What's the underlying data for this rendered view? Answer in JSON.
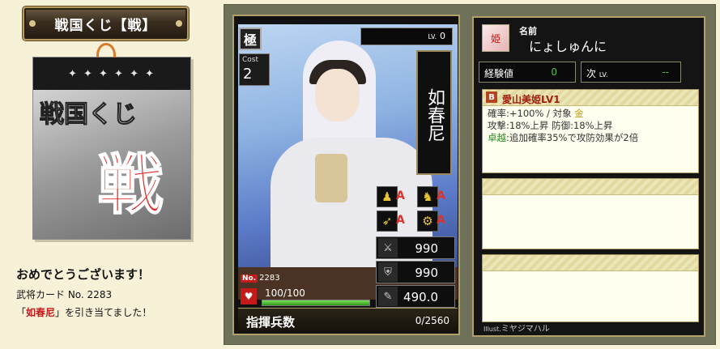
{
  "left": {
    "title": "戦国くじ【戦】",
    "art": {
      "strip_text": "✦ ✦ ✦ ✦ ✦ ✦",
      "big_text": "戦国くじ",
      "big_red": "戦"
    },
    "messages": {
      "congrats": "おめでとうございます！",
      "card_line": "武将カード No. 2283",
      "result_prefix": "「",
      "result_name": "如春尼",
      "result_suffix": "」を引き当てました！"
    }
  },
  "card": {
    "rarity": "極",
    "cost_label": "Cost",
    "cost_value": "2",
    "level_label": "LV.",
    "level_value": "0",
    "name": "如春尼",
    "skill_icons": [
      "spear-icon",
      "horse-icon",
      "bow-icon",
      "cannon-icon"
    ],
    "skill_grades": [
      "A",
      "A",
      "A",
      "A"
    ],
    "stats": {
      "attack": "990",
      "defense": "990",
      "speed": "490.0"
    },
    "number_label": "No.",
    "number": "2283",
    "hp_text": "100/100",
    "hp_fraction": 1.0,
    "troop_label": "指揮兵数",
    "troop_value": "0/2560"
  },
  "info": {
    "avatar_text": "姫",
    "name_label": "名前",
    "name_value": "にょしゅんに",
    "exp_label": "経験値",
    "exp_value": "0",
    "next_label": "次",
    "next_label_small": "LV.",
    "next_value": "--",
    "skill": {
      "badge": "B",
      "name": "愛山美姫LV1",
      "line1_a": "確率:+100%  /  対象 ",
      "line1_b": "金",
      "line2": "攻撃:18%上昇 防御:18%上昇",
      "line3_a": "卓越",
      "line3_b": ":追加確率35%で攻防効果が2倍"
    },
    "illust_label": "Illust.",
    "illust_value": "ミヤジマハル"
  }
}
